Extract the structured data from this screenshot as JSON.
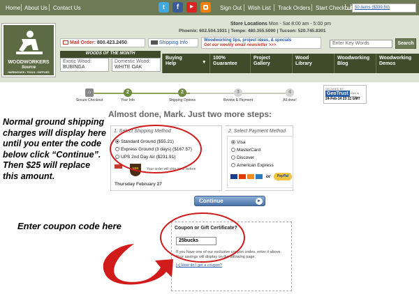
{
  "top_nav": {
    "about": "Home",
    "about_us": "About Us",
    "contact": "Contact Us",
    "sign_out": "Sign Out",
    "wish_list": "Wish List",
    "track": "Track Orders",
    "checkout": "Start Checkout",
    "cart": "50 items ($339.50)"
  },
  "header": {
    "store_line_label": "Store Locations",
    "store_line": "Mon - Sat 8:00 am - 5:00 pm",
    "phones": "Phoenix: 602.504.1931  |  Tempe: 480.355.5090  |  Tucson: 520.745.8301",
    "mail_label": "Mail Order:",
    "mail_phone": "800.423.2450",
    "shipping_info": "Shipping Info",
    "tips_line1": "Woodworking tips, project ideas, & specials",
    "tips_line2": "Get our weekly email newsletter >>>",
    "search_placeholder": "Enter Key Words",
    "search_button": "Search",
    "logo_line1": "WOODWORKERS",
    "logo_line2": "Source",
    "logo_line3": "HARDWOODS • TOOLS • SUPPLIES"
  },
  "woods": {
    "heading": "WOODS OF THE MONTH",
    "exotic_label": "Exotic Wood:",
    "exotic_value": "BUBINGA",
    "domestic_label": "Domestic Wood:",
    "domestic_value": "WHITE OAK"
  },
  "nav_items": [
    {
      "label": "Buying Help"
    },
    {
      "label": "100% Guarantee"
    },
    {
      "label": "Project Gallery"
    },
    {
      "label": "Wood Library"
    },
    {
      "label": "Woodworking Blog"
    },
    {
      "label": "Woodworking Demos"
    }
  ],
  "steps": [
    {
      "num": "1",
      "label": "Secure Checkout"
    },
    {
      "num": "2",
      "label": "Your Info"
    },
    {
      "num": "2",
      "label": "Shipping Options"
    },
    {
      "num": "3",
      "label": "Review & Payment"
    },
    {
      "num": "4",
      "label": "All done!"
    }
  ],
  "geotrust": {
    "secured": "SECURED BY",
    "brand": "GeoTrust",
    "verify": "click to verify",
    "date": "24-Feb-14 23:11 GMT"
  },
  "page_title": "Almost done, Mark. Just two more steps:",
  "shipping": {
    "heading": "1. Select Shipping Method",
    "options": [
      {
        "label": "Standard Ground ($55.21)",
        "selected": true
      },
      {
        "label": "Express Ground (3 days) ($167.57)",
        "selected": false
      },
      {
        "label": "UPS 2nd Day Air ($231.91)",
        "selected": false
      }
    ],
    "note": "Your order will ship on or before",
    "ship_date": "Thursday February 27"
  },
  "payment": {
    "heading": "2. Select Payment Method",
    "options": [
      {
        "label": "Visa",
        "selected": true
      },
      {
        "label": "MasterCard",
        "selected": false
      },
      {
        "label": "Discover",
        "selected": false
      },
      {
        "label": "American Express",
        "selected": false
      }
    ],
    "or": "or",
    "paypal": "PayPal"
  },
  "continue_button": "Continue",
  "coupon": {
    "heading": "Coupon or Gift Certificate?",
    "value": "25bucks",
    "help": "If you have one of our exclusive coupon codes, enter it above. Your savings will display on the following page.",
    "link": "[+] How do I get a coupon?"
  },
  "annotations": {
    "left_note": "Normal ground shipping charges will display here until you enter the code below click “Continue”. Then $25 will replace this amount.",
    "coupon_note": "Enter coupon code here"
  },
  "colors": {
    "nav_dark": "#3f4b2b",
    "nav_mid": "#6d7a55",
    "header_bg": "#dfe3d4",
    "annotation_red": "#d11a1a"
  }
}
